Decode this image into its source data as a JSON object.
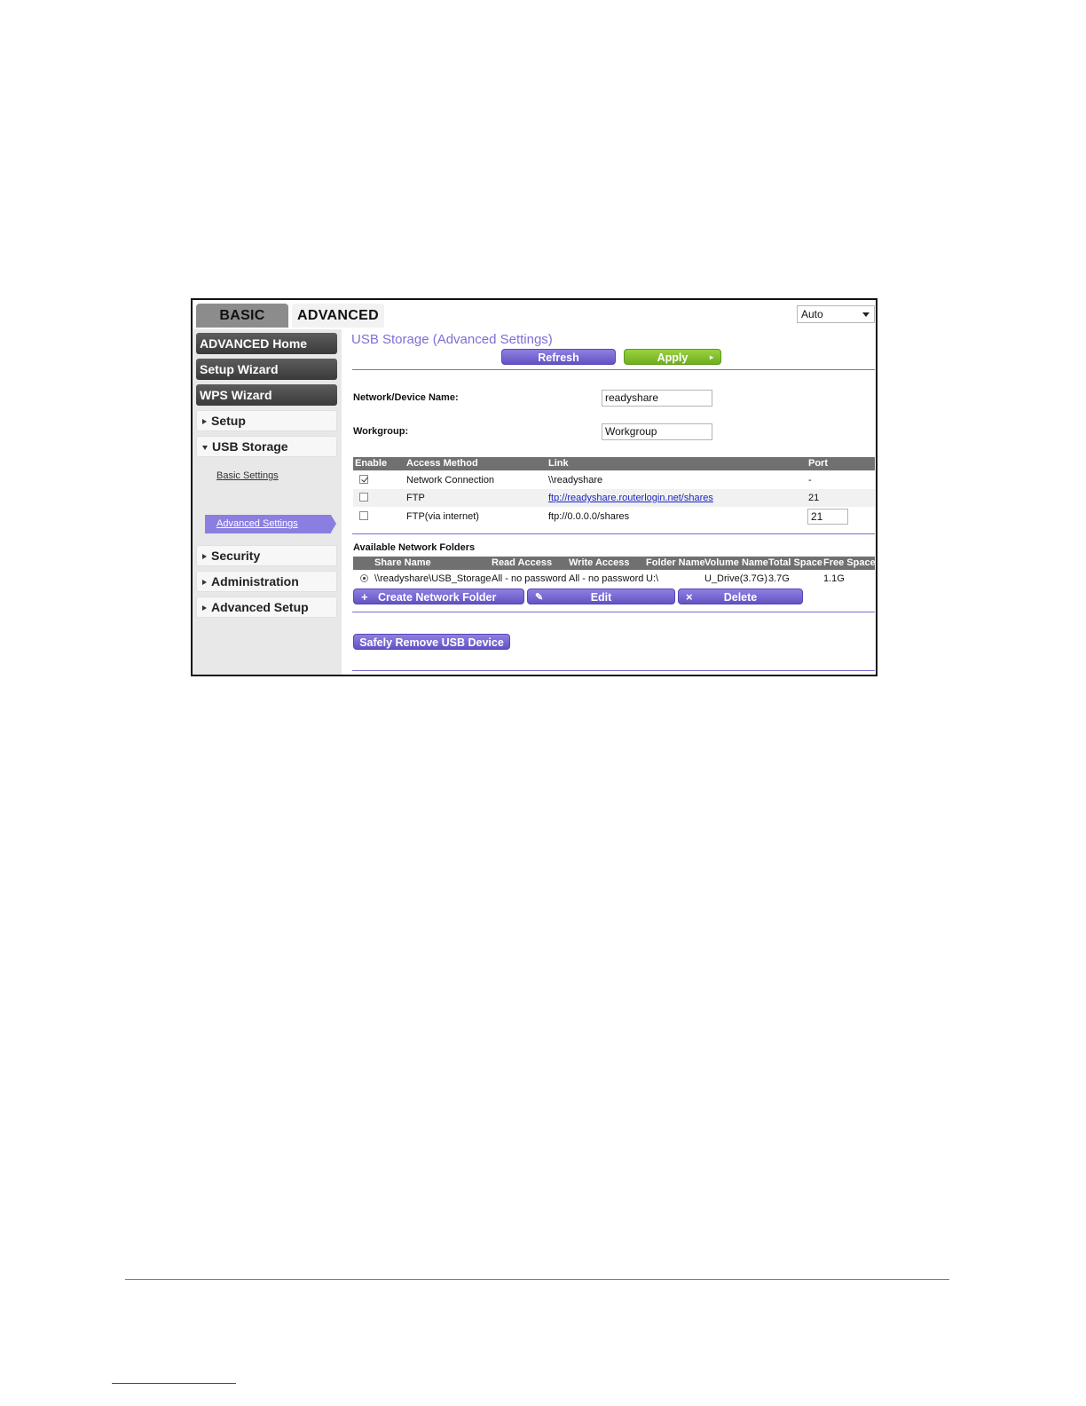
{
  "tabs": {
    "basic": "BASIC",
    "advanced": "ADVANCED"
  },
  "language": {
    "selected": "Auto"
  },
  "sidebar": {
    "buttons": [
      "ADVANCED Home",
      "Setup Wizard",
      "WPS Wizard"
    ],
    "sections": {
      "setup": "Setup",
      "usb_storage": "USB Storage",
      "security": "Security",
      "administration": "Administration",
      "advanced_setup": "Advanced Setup"
    },
    "usb_sub": {
      "basic": "Basic Settings",
      "advanced": "Advanced Settings"
    }
  },
  "main": {
    "title": "USB Storage (Advanced Settings)",
    "refresh_label": "Refresh",
    "apply_label": "Apply",
    "device_name_label": "Network/Device Name:",
    "device_name_value": "readyshare",
    "workgroup_label": "Workgroup:",
    "workgroup_value": "Workgroup"
  },
  "access_table": {
    "headers": [
      "Enable",
      "Access Method",
      "Link",
      "Port"
    ],
    "rows": [
      {
        "enabled": true,
        "method": "Network Connection",
        "link": "\\\\readyshare",
        "port": "-"
      },
      {
        "enabled": false,
        "method": "FTP",
        "link": "ftp://readyshare.routerlogin.net/shares",
        "port": "21"
      },
      {
        "enabled": false,
        "method": "FTP(via internet)",
        "link": "ftp://0.0.0.0/shares",
        "port": "21"
      }
    ]
  },
  "folders": {
    "heading": "Available Network Folders",
    "headers": [
      "Share Name",
      "Read Access",
      "Write Access",
      "Folder Name",
      "Volume Name",
      "Total Space",
      "Free Space"
    ],
    "rows": [
      {
        "share": "\\\\readyshare\\USB_Storage",
        "read": "All - no password",
        "write": "All - no password",
        "folder": "U:\\",
        "volume": "U_Drive(3.7G)",
        "total": "3.7G",
        "free": "1.1G"
      }
    ],
    "create_label": "Create Network Folder",
    "edit_label": "Edit",
    "delete_label": "Delete"
  },
  "safely_remove_label": "Safely Remove USB Device"
}
